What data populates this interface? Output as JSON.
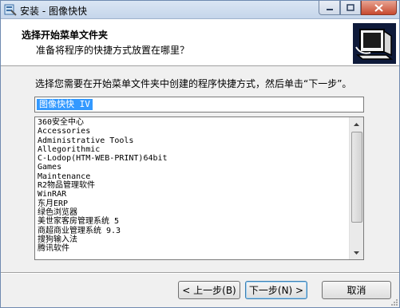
{
  "window": {
    "title": "安装 - 图像快快"
  },
  "header": {
    "title": "选择开始菜单文件夹",
    "subtitle": "准备将程序的快捷方式放置在哪里？"
  },
  "instruction": "选择您需要在开始菜单文件夹中创建的程序快捷方式，然后单击“下一步”。",
  "folder_field": {
    "value": "图像快快 IV"
  },
  "folders": [
    "360安全中心",
    "Accessories",
    "Administrative Tools",
    "Allegorithmic",
    "C-Lodop(HTM-WEB-PRINT)64bit",
    "Games",
    "Maintenance",
    "R2物品管理软件",
    "WinRAR",
    "东月ERP",
    "绿色浏览器",
    "美世家客房管理系统 5",
    "商超商业管理系统 9.3",
    "搜狗输入法",
    "腾讯软件"
  ],
  "buttons": {
    "back": "< 上一步(B)",
    "next": "下一步(N) >",
    "cancel": "取消"
  },
  "colors": {
    "selection": "#3399ff",
    "header_bg": "#ffffff",
    "window_bg": "#f0f0f0"
  }
}
